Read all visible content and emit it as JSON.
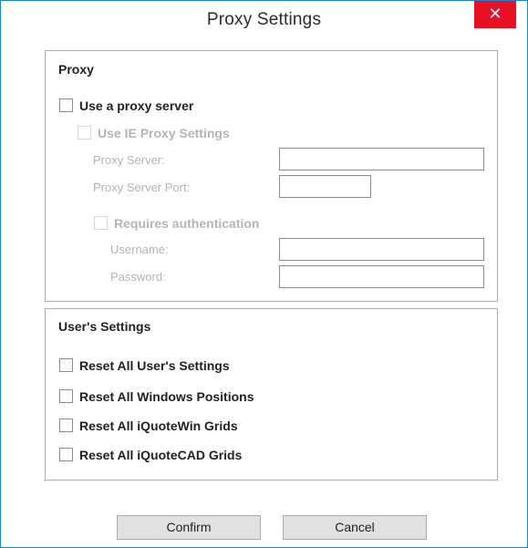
{
  "window": {
    "title": "Proxy Settings",
    "close_glyph": "✕"
  },
  "proxy": {
    "group_title": "Proxy",
    "use_proxy_label": "Use a proxy server",
    "use_ie_label": "Use IE Proxy Settings",
    "server_label": "Proxy Server:",
    "server_value": "",
    "port_label": "Proxy Server Port:",
    "port_value": "",
    "auth_label": "Requires authentication",
    "username_label": "Username:",
    "username_value": "",
    "password_label": "Password:",
    "password_value": ""
  },
  "users": {
    "group_title": "User's Settings",
    "reset_settings_label": "Reset All User's Settings",
    "reset_windows_label": "Reset All Windows Positions",
    "reset_iquotewin_label": "Reset All iQuoteWin Grids",
    "reset_iquotecad_label": "Reset All iQuoteCAD Grids"
  },
  "buttons": {
    "confirm_label": "Confirm",
    "cancel_label": "Cancel"
  },
  "colors": {
    "accent_border": "#1883d7",
    "close_bg": "#e81123",
    "disabled_text": "#b4b4b4"
  }
}
